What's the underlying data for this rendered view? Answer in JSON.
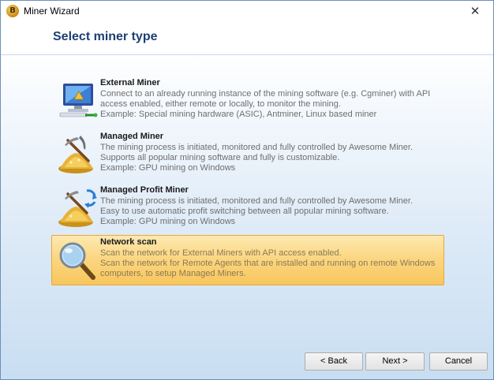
{
  "window": {
    "title": "Miner Wizard",
    "app_icon_glyph": "B",
    "close_glyph": "✕"
  },
  "header": {
    "title": "Select miner type"
  },
  "options": [
    {
      "title": "External Miner",
      "lines": [
        "Connect to an already running instance of the mining software (e.g. Cgminer) with API",
        "access enabled, either remote or locally, to monitor the mining.",
        "Example: Special mining hardware (ASIC), Antminer, Linux based miner"
      ],
      "icon": "computer-monitor-icon",
      "selected": false
    },
    {
      "title": "Managed Miner",
      "lines": [
        "The mining process is initiated, monitored and fully controlled by Awesome Miner.",
        "Supports all popular mining software and fully is customizable.",
        "Example: GPU mining on Windows"
      ],
      "icon": "pickaxe-gold-icon",
      "selected": false
    },
    {
      "title": "Managed Profit Miner",
      "lines": [
        "The mining process is initiated, monitored and fully controlled by Awesome Miner.",
        "Easy to use automatic profit switching between all popular mining software.",
        "Example: GPU mining on Windows"
      ],
      "icon": "pickaxe-gold-refresh-icon",
      "selected": false
    },
    {
      "title": "Network scan",
      "lines": [
        "Scan the network for External Miners with API access enabled.",
        "Scan the network for Remote Agents that are installed and running on remote Windows",
        "computers, to setup Managed Miners."
      ],
      "icon": "magnifier-icon",
      "selected": true
    }
  ],
  "buttons": {
    "back": "< Back",
    "next": "Next >",
    "cancel": "Cancel"
  }
}
